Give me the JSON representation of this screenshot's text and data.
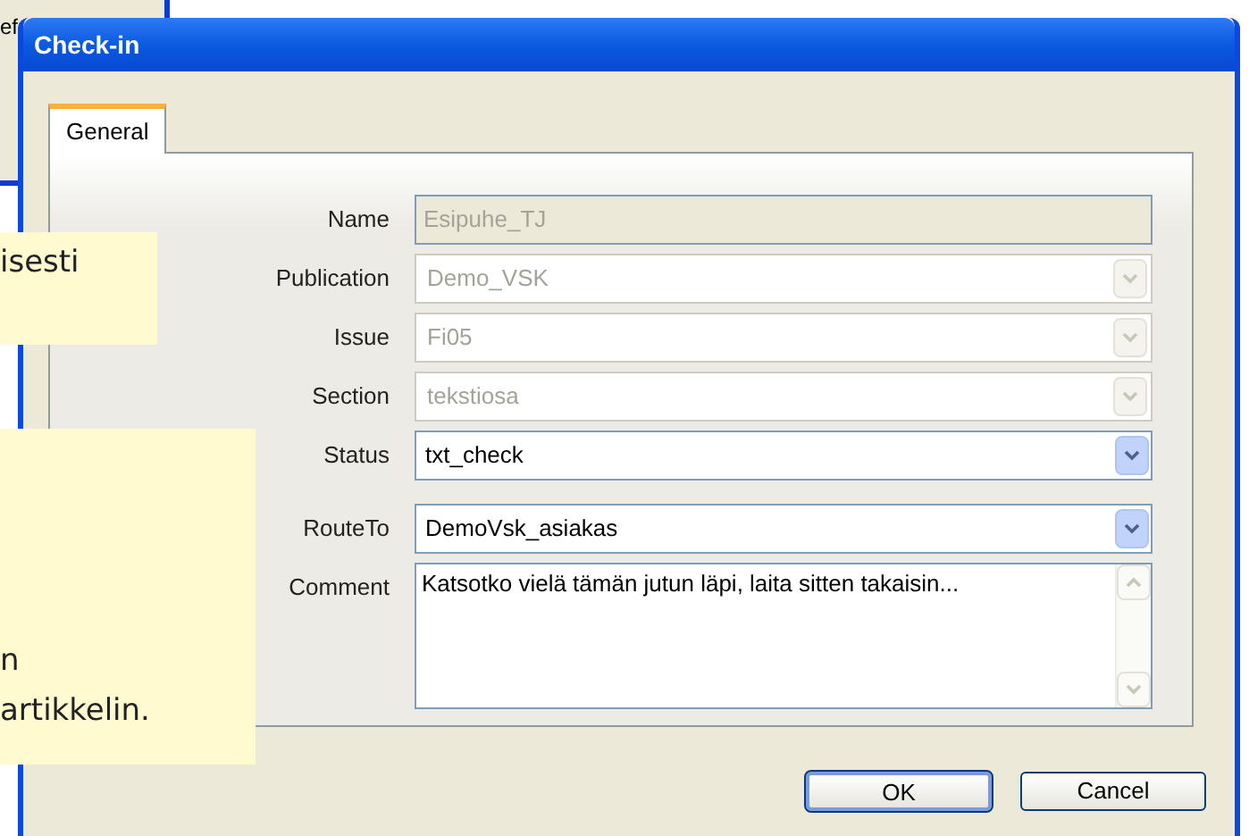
{
  "background_window": {
    "text": "ef"
  },
  "callouts": [
    {
      "lines": [
        "isesti"
      ]
    },
    {
      "lines": [
        "n",
        "artikkelin."
      ]
    }
  ],
  "dialog": {
    "title": "Check-in",
    "tabs": [
      {
        "label": "General",
        "selected": true
      }
    ],
    "fields": [
      {
        "label": "Name",
        "kind": "text",
        "value": "Esipuhe_TJ",
        "disabled": true
      },
      {
        "label": "Publication",
        "kind": "dropdown",
        "value": "Demo_VSK",
        "disabled": true
      },
      {
        "label": "Issue",
        "kind": "dropdown",
        "value": "Fi05",
        "disabled": true
      },
      {
        "label": "Section",
        "kind": "dropdown",
        "value": "tekstiosa",
        "disabled": true
      },
      {
        "label": "Status",
        "kind": "dropdown",
        "value": "txt_check",
        "disabled": false
      },
      {
        "label": "RouteTo",
        "kind": "dropdown",
        "value": "DemoVsk_asiakas",
        "disabled": false
      },
      {
        "label": "Comment",
        "kind": "textarea",
        "value": "Katsotko vielä tämän jutun läpi, laita sitten takaisin...",
        "disabled": false
      }
    ],
    "buttons": [
      {
        "label": "OK",
        "default": true
      },
      {
        "label": "Cancel",
        "default": false
      }
    ]
  }
}
